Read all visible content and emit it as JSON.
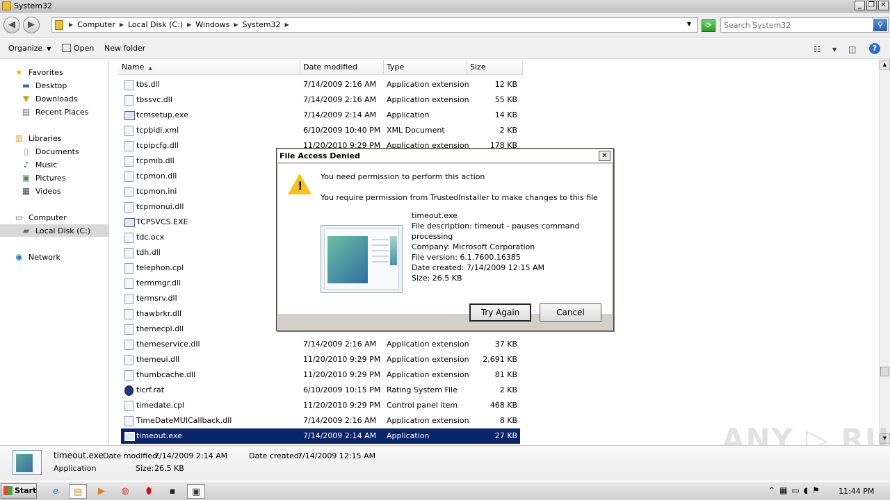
{
  "window": {
    "title": "System32",
    "min": "_",
    "restore": "❐",
    "close": "✕"
  },
  "address": {
    "back": "◀",
    "forward": "▶",
    "crumbs": [
      "Computer",
      "Local Disk (C:)",
      "Windows",
      "System32"
    ],
    "search_placeholder": "Search System32",
    "refresh_icon": "⟳",
    "search_icon": "⚲"
  },
  "command_bar": {
    "organize": "Organize",
    "open": "Open",
    "new_folder": "New folder",
    "help": "?"
  },
  "nav": {
    "favorites": "Favorites",
    "desktop": "Desktop",
    "downloads": "Downloads",
    "recent_places": "Recent Places",
    "libraries": "Libraries",
    "documents": "Documents",
    "music": "Music",
    "pictures": "Pictures",
    "videos": "Videos",
    "computer": "Computer",
    "local_disk": "Local Disk (C:)",
    "network": "Network"
  },
  "columns": {
    "name": "Name",
    "date": "Date modified",
    "type": "Type",
    "size": "Size"
  },
  "files": [
    {
      "name": "tbs.dll",
      "date": "7/14/2009 2:16 AM",
      "type": "Application extension",
      "size": "12 KB"
    },
    {
      "name": "tbssvc.dll",
      "date": "7/14/2009 2:16 AM",
      "type": "Application extension",
      "size": "55 KB"
    },
    {
      "name": "tcmsetup.exe",
      "date": "7/14/2009 2:14 AM",
      "type": "Application",
      "size": "14 KB"
    },
    {
      "name": "tcpbidi.xml",
      "date": "6/10/2009 10:40 PM",
      "type": "XML Document",
      "size": "2 KB"
    },
    {
      "name": "tcpipcfg.dll",
      "date": "11/20/2010 9:29 PM",
      "type": "Application extension",
      "size": "178 KB"
    },
    {
      "name": "tcpmib.dll",
      "date": "",
      "type": "",
      "size": ""
    },
    {
      "name": "tcpmon.dll",
      "date": "",
      "type": "",
      "size": ""
    },
    {
      "name": "tcpmon.ini",
      "date": "",
      "type": "",
      "size": ""
    },
    {
      "name": "tcpmonui.dll",
      "date": "",
      "type": "",
      "size": ""
    },
    {
      "name": "TCPSVCS.EXE",
      "date": "",
      "type": "",
      "size": ""
    },
    {
      "name": "tdc.ocx",
      "date": "",
      "type": "",
      "size": ""
    },
    {
      "name": "tdh.dll",
      "date": "",
      "type": "",
      "size": ""
    },
    {
      "name": "telephon.cpl",
      "date": "",
      "type": "",
      "size": ""
    },
    {
      "name": "termmgr.dll",
      "date": "",
      "type": "",
      "size": ""
    },
    {
      "name": "termsrv.dll",
      "date": "",
      "type": "",
      "size": ""
    },
    {
      "name": "thawbrkr.dll",
      "date": "",
      "type": "",
      "size": ""
    },
    {
      "name": "themecpl.dll",
      "date": "",
      "type": "",
      "size": ""
    },
    {
      "name": "themeservice.dll",
      "date": "7/14/2009 2:16 AM",
      "type": "Application extension",
      "size": "37 KB"
    },
    {
      "name": "themeui.dll",
      "date": "11/20/2010 9:29 PM",
      "type": "Application extension",
      "size": "2,691 KB"
    },
    {
      "name": "thumbcache.dll",
      "date": "11/20/2010 9:29 PM",
      "type": "Application extension",
      "size": "81 KB"
    },
    {
      "name": "ticrf.rat",
      "date": "6/10/2009 10:15 PM",
      "type": "Rating System File",
      "size": "2 KB"
    },
    {
      "name": "timedate.cpl",
      "date": "11/20/2010 9:29 PM",
      "type": "Control panel item",
      "size": "468 KB"
    },
    {
      "name": "TimeDateMUICallback.dll",
      "date": "7/14/2009 2:16 AM",
      "type": "Application extension",
      "size": "8 KB"
    },
    {
      "name": "timeout.exe",
      "date": "7/14/2009 2:14 AM",
      "type": "Application",
      "size": "27 KB"
    }
  ],
  "details": {
    "name": "timeout.exe",
    "modified_label": "Date modified:",
    "modified": "7/14/2009 2:14 AM",
    "created_label": "Date created:",
    "created": "7/14/2009 12:15 AM",
    "type": "Application",
    "size_label": "Size:",
    "size": "26.5 KB"
  },
  "watermark": "ANY ▷ RUN",
  "dialog": {
    "title": "File Access Denied",
    "close": "✕",
    "message1": "You need permission to perform this action",
    "message2": "You require permission from TrustedInstaller to make changes to this file",
    "file_name": "timeout.exe",
    "description_1": "File description: timeout - pauses command",
    "description_2": "processing",
    "company": "Company: Microsoft Corporation",
    "version": "File version: 6.1.7600.16385",
    "created": "Date created: 7/14/2009 12:15 AM",
    "size": "Size: 26.5 KB",
    "try_again": "Try Again",
    "cancel": "Cancel"
  },
  "taskbar": {
    "start": "Start",
    "clock": "11:44 PM"
  }
}
